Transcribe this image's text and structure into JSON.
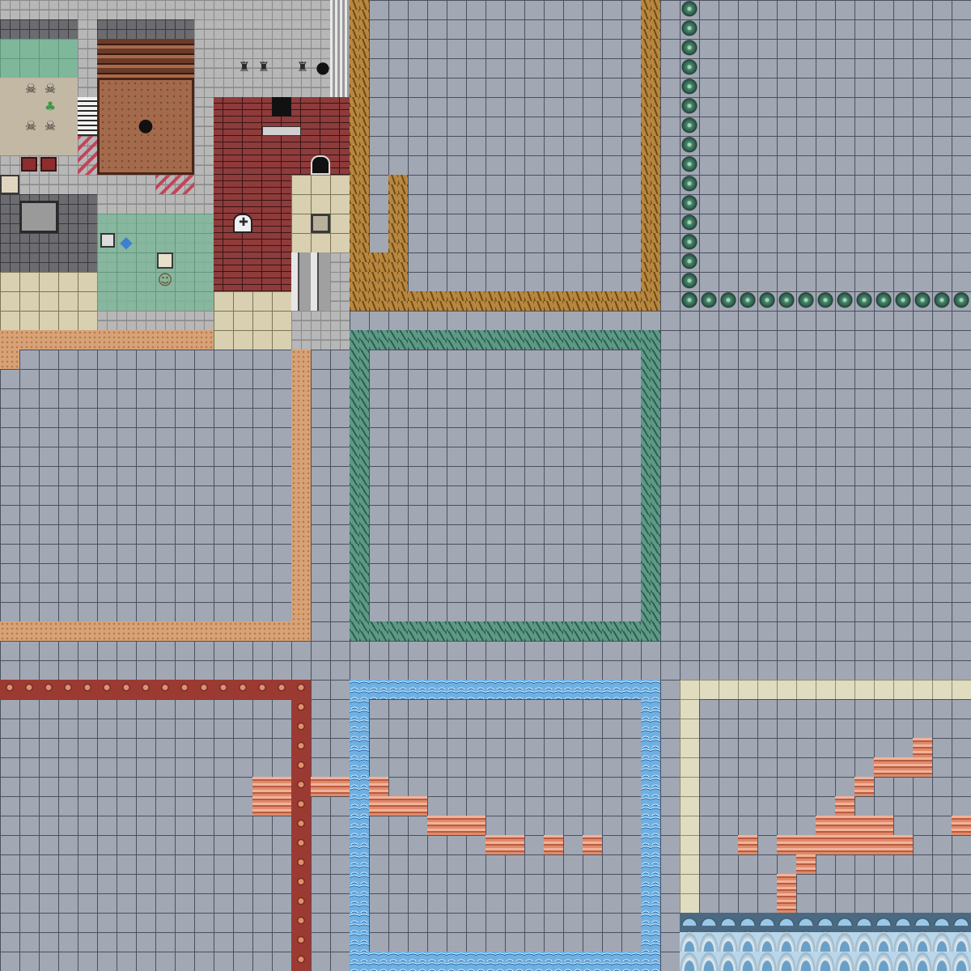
{
  "app": {
    "kind": "tileset-map-editor-view"
  },
  "colors": {
    "background": "#a2a7b4",
    "grid": "#4a5060",
    "sand_frame": "#d8a276",
    "grass_frame": "#5d9a86",
    "leaf_frame": "#b8873e",
    "red_rock_frame": "#9b3a32",
    "water_frame": "#6fb0e2",
    "bone_frame": "#dfdcc0",
    "tree_border": "#2a5646",
    "brick_wall": "#8e3b3b"
  },
  "icons": {
    "hole": "black-hole-icon",
    "skull": "skull-icon",
    "chest": "treasure-chest-icon",
    "mushroom": "mushroom-icon",
    "statue": "owl-statue-icon",
    "door": "door-icon",
    "window": "cross-window-icon",
    "crystal": "blue-crystal-icon",
    "character": "character-sprite-icon"
  }
}
